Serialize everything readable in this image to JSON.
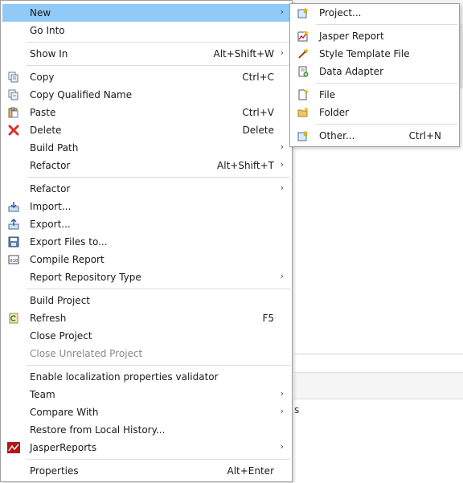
{
  "menu": {
    "items": [
      {
        "label": "New",
        "shortcut": "",
        "arrow": "›"
      },
      {
        "label": "Go Into",
        "shortcut": "",
        "arrow": ""
      },
      {
        "label": "Show In",
        "shortcut": "Alt+Shift+W",
        "arrow": "›"
      },
      {
        "label": "Copy",
        "shortcut": "Ctrl+C",
        "arrow": ""
      },
      {
        "label": "Copy Qualified Name",
        "shortcut": "",
        "arrow": ""
      },
      {
        "label": "Paste",
        "shortcut": "Ctrl+V",
        "arrow": ""
      },
      {
        "label": "Delete",
        "shortcut": "Delete",
        "arrow": ""
      },
      {
        "label": "Build Path",
        "shortcut": "",
        "arrow": "›"
      },
      {
        "label": "Refactor",
        "shortcut": "Alt+Shift+T",
        "arrow": "›"
      },
      {
        "label": "Refactor",
        "shortcut": "",
        "arrow": "›"
      },
      {
        "label": "Import...",
        "shortcut": "",
        "arrow": ""
      },
      {
        "label": "Export...",
        "shortcut": "",
        "arrow": ""
      },
      {
        "label": "Export Files to...",
        "shortcut": "",
        "arrow": ""
      },
      {
        "label": "Compile Report",
        "shortcut": "",
        "arrow": ""
      },
      {
        "label": "Report Repository Type",
        "shortcut": "",
        "arrow": "›"
      },
      {
        "label": "Build Project",
        "shortcut": "",
        "arrow": ""
      },
      {
        "label": "Refresh",
        "shortcut": "F5",
        "arrow": ""
      },
      {
        "label": "Close Project",
        "shortcut": "",
        "arrow": ""
      },
      {
        "label": "Close Unrelated Project",
        "shortcut": "",
        "arrow": ""
      },
      {
        "label": "Enable localization properties validator",
        "shortcut": "",
        "arrow": ""
      },
      {
        "label": "Team",
        "shortcut": "",
        "arrow": "›"
      },
      {
        "label": "Compare With",
        "shortcut": "",
        "arrow": "›"
      },
      {
        "label": "Restore from Local History...",
        "shortcut": "",
        "arrow": ""
      },
      {
        "label": "JasperReports",
        "shortcut": "",
        "arrow": "›"
      },
      {
        "label": "Properties",
        "shortcut": "Alt+Enter",
        "arrow": ""
      }
    ]
  },
  "submenu": {
    "items": [
      {
        "label": "Project...",
        "shortcut": ""
      },
      {
        "label": "Jasper Report",
        "shortcut": ""
      },
      {
        "label": "Style Template File",
        "shortcut": ""
      },
      {
        "label": "Data Adapter",
        "shortcut": ""
      },
      {
        "label": "File",
        "shortcut": ""
      },
      {
        "label": "Folder",
        "shortcut": ""
      },
      {
        "label": "Other...",
        "shortcut": "Ctrl+N"
      }
    ]
  },
  "background": {
    "fragment_text": "s"
  },
  "colors": {
    "highlight": "#91c9f7",
    "disabled": "#8a8a8a",
    "separator": "#dcdcdc"
  }
}
